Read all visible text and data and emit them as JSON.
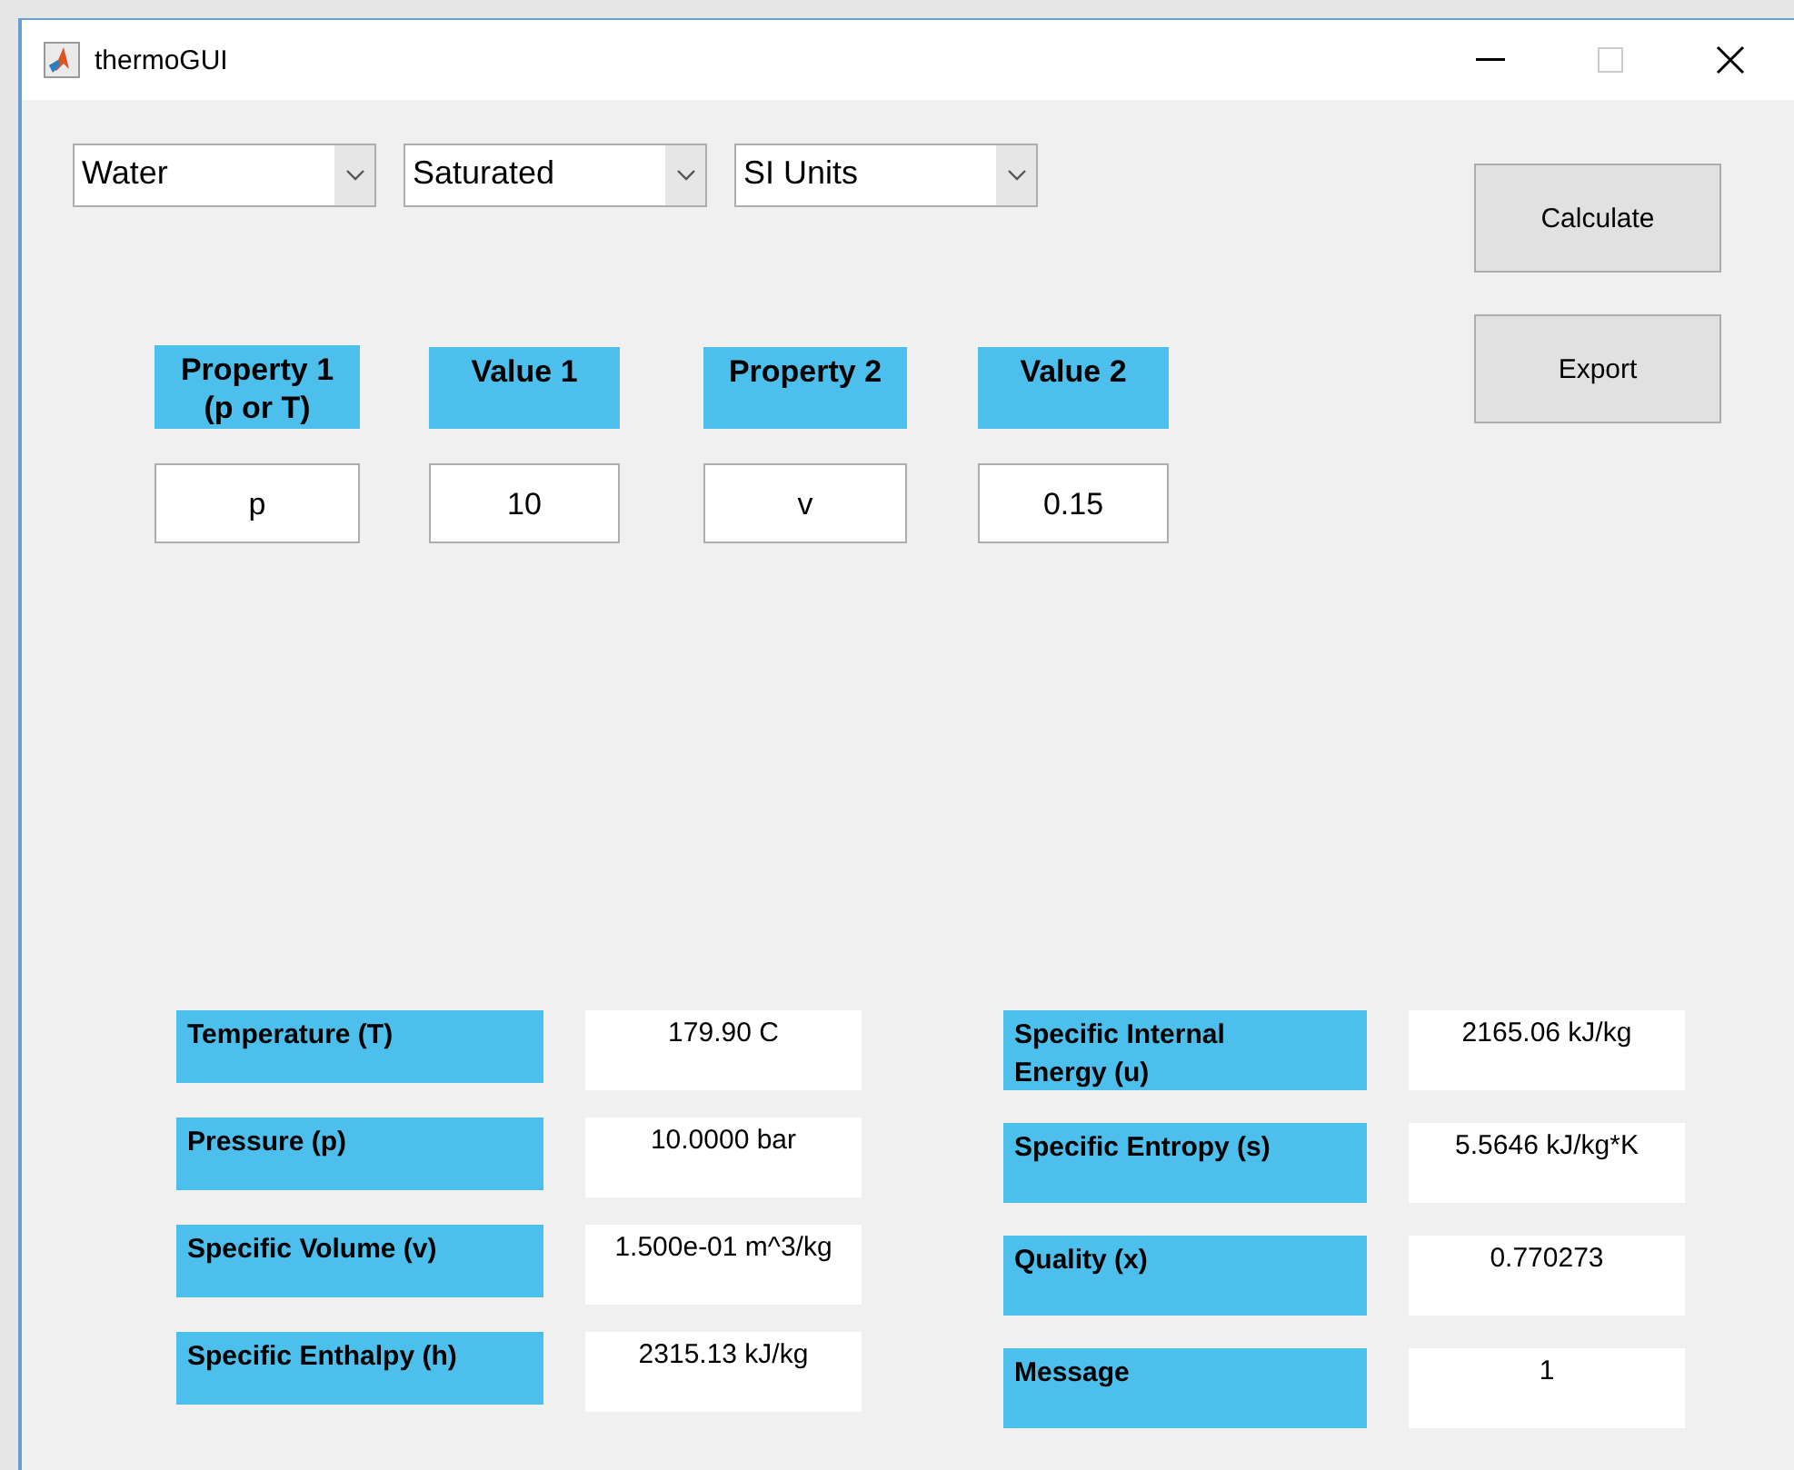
{
  "window": {
    "title": "thermoGUI"
  },
  "dropdowns": [
    {
      "value": "Water"
    },
    {
      "value": "Saturated"
    },
    {
      "value": "SI Units"
    }
  ],
  "buttons": [
    "Calculate",
    "Export"
  ],
  "inputs": [
    {
      "label": "Property 1 (p or T)",
      "value": "p"
    },
    {
      "label": "Value 1",
      "value": "10"
    },
    {
      "label": "Property 2",
      "value": "v"
    },
    {
      "label": "Value 2",
      "value": "0.15"
    }
  ],
  "results_left": [
    {
      "label": "Temperature (T)",
      "value": "179.90 C"
    },
    {
      "label": "Pressure (p)",
      "value": "10.0000 bar"
    },
    {
      "label": "Specific Volume (v)",
      "value": "1.500e-01 m^3/kg"
    },
    {
      "label": "Specific Enthalpy (h)",
      "value": "2315.13 kJ/kg"
    }
  ],
  "results_right": [
    {
      "label": "Specific Internal Energy (u)",
      "value": "2165.06 kJ/kg"
    },
    {
      "label": "Specific Entropy (s)",
      "value": "5.5646 kJ/kg*K"
    },
    {
      "label": "Quality (x)",
      "value": "0.770273"
    },
    {
      "label": "Message",
      "value": "1"
    }
  ]
}
